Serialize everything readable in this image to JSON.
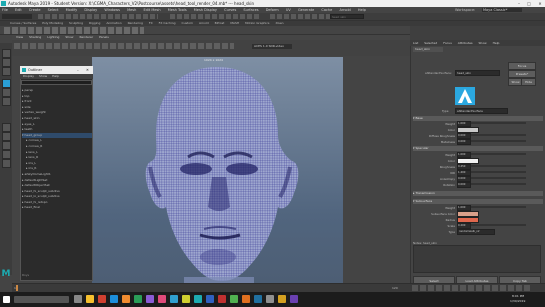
{
  "window": {
    "title": "Autodesk Maya 2019 - Student Version: X:\\CGMA_Characters_V2\\Postcourse\\assets\\head_tool_render_04.mb* --- head_skin",
    "minimize": "–",
    "maximize": "□",
    "close": "✕"
  },
  "menu": [
    "File",
    "Edit",
    "Create",
    "Select",
    "Modify",
    "Display",
    "Windows",
    "Mesh",
    "Edit Mesh",
    "Mesh Tools",
    "Mesh Display",
    "Curves",
    "Surfaces",
    "Deform",
    "UV",
    "Generate",
    "Cache",
    "Arnold",
    "Help"
  ],
  "workspace": {
    "label": "Workspace:",
    "value": "Maya Classic*"
  },
  "search_placeholder": "head_skin",
  "shelf_tabs": [
    "Curves / Surfaces",
    "Poly Modeling",
    "Sculpting",
    "Rigging",
    "Animation",
    "Rendering",
    "FX",
    "FX Caching",
    "Custom",
    "Arnold",
    "Bifrost",
    "MASH",
    "Motion Graphics",
    "XGen"
  ],
  "panel_menu": [
    "View",
    "Shading",
    "Lighting",
    "Show",
    "Renderer",
    "Panels"
  ],
  "viewport": {
    "camera_label": "persp",
    "fps_hint": "1024 x 1024",
    "color_space": "ACES 1.0 SDR-video"
  },
  "outliner": {
    "title": "Outliner",
    "menu": [
      "Display",
      "Show",
      "Help"
    ],
    "items": [
      "persp",
      "top",
      "front",
      "side",
      "vertex_weight",
      "head_skin",
      "eyes_L",
      "teeth",
      "head_group",
      "cornea_L",
      "cornea_R",
      "lens_L",
      "lens_R",
      "iris_L",
      "iris_R",
      "aiSkyDomeLight1",
      "defaultLightSet",
      "defaultObjectSet",
      "head_hi_sculpt_subdivs",
      "head_lo_sculpt_subdivs",
      "head_hi_retopo",
      "head_final"
    ],
    "footer": "Roys"
  },
  "attr": {
    "tabs": [
      "List",
      "Selected",
      "Focus",
      "Attributes",
      "Show",
      "Help"
    ],
    "node_tab": "head_skin",
    "node_label": "aiStandardSurface:",
    "node_value": "head_skin",
    "focus_btn": "Focus",
    "presets_btn": "Presets*",
    "show_btn": "Show",
    "hide_btn": "Hide",
    "swatch_label": "Sample",
    "type_label": "Type",
    "type_value": "aiStandardSurface",
    "sections": [
      "Base",
      "Specular",
      "Transmission",
      "Subsurface"
    ],
    "base_rows": [
      {
        "label": "Weight",
        "value": "1.000"
      },
      {
        "label": "Color",
        "value": ""
      },
      {
        "label": "Diffuse Roughness",
        "value": "0.000"
      },
      {
        "label": "Metalness",
        "value": "0.000"
      }
    ],
    "spec_rows": [
      {
        "label": "Weight",
        "value": "1.000"
      },
      {
        "label": "Color",
        "value": ""
      },
      {
        "label": "Roughness",
        "value": "0.450"
      },
      {
        "label": "IOR",
        "value": "1.400"
      },
      {
        "label": "Anisotropy",
        "value": "0.000"
      },
      {
        "label": "Rotation",
        "value": "0.000"
      }
    ],
    "sss_rows": [
      {
        "label": "Weight",
        "value": "1.000"
      },
      {
        "label": "Subsurface Color",
        "value": ""
      },
      {
        "label": "Radius",
        "value": ""
      },
      {
        "label": "Scale",
        "value": "0.200"
      },
      {
        "label": "Type",
        "value": "randomwalk_v2"
      }
    ],
    "notes_label": "Notes:  head_skin",
    "buttons": [
      "Select",
      "Load Attributes",
      "Copy Tab"
    ]
  },
  "timeslider": {
    "start": "1",
    "end": "120",
    "current": "1"
  },
  "taskbar": {
    "time": "8:01 PM",
    "date": "1/30/2019"
  },
  "colors": {
    "accent": "#2a9fd6",
    "wire": "#2a2a8a",
    "maya_teal": "#1dabb1"
  }
}
